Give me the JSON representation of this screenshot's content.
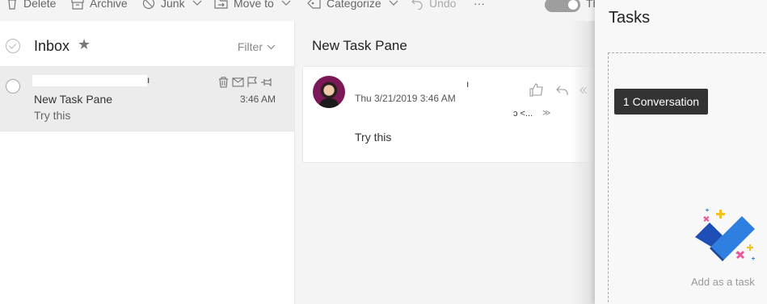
{
  "toolbar": {
    "delete_label": "Delete",
    "archive_label": "Archive",
    "junk_label": "Junk",
    "moveto_label": "Move to",
    "categorize_label": "Categorize",
    "undo_label": "Undo",
    "more_label": "···",
    "toggle_label": "Th"
  },
  "list": {
    "title": "Inbox",
    "star": "★",
    "filter_label": "Filter",
    "messages": [
      {
        "sender_visible": "ı",
        "subject": "New Task Pane",
        "preview": "Try this",
        "time": "3:46 AM"
      }
    ]
  },
  "reading": {
    "title": "New Task Pane",
    "from_visible": "ı",
    "date": "Thu 3/21/2019 3:46 AM",
    "to_visible": "ɔ <...",
    "expand": "≫",
    "body": "Try this"
  },
  "tasks": {
    "title": "Tasks",
    "drop_badge": "1 Conversation",
    "add_label": "Add as a task"
  },
  "colors": {
    "accent_blue": "#2f7fe0",
    "dark_blue": "#1d4fb6",
    "badge_bg": "#333333"
  }
}
